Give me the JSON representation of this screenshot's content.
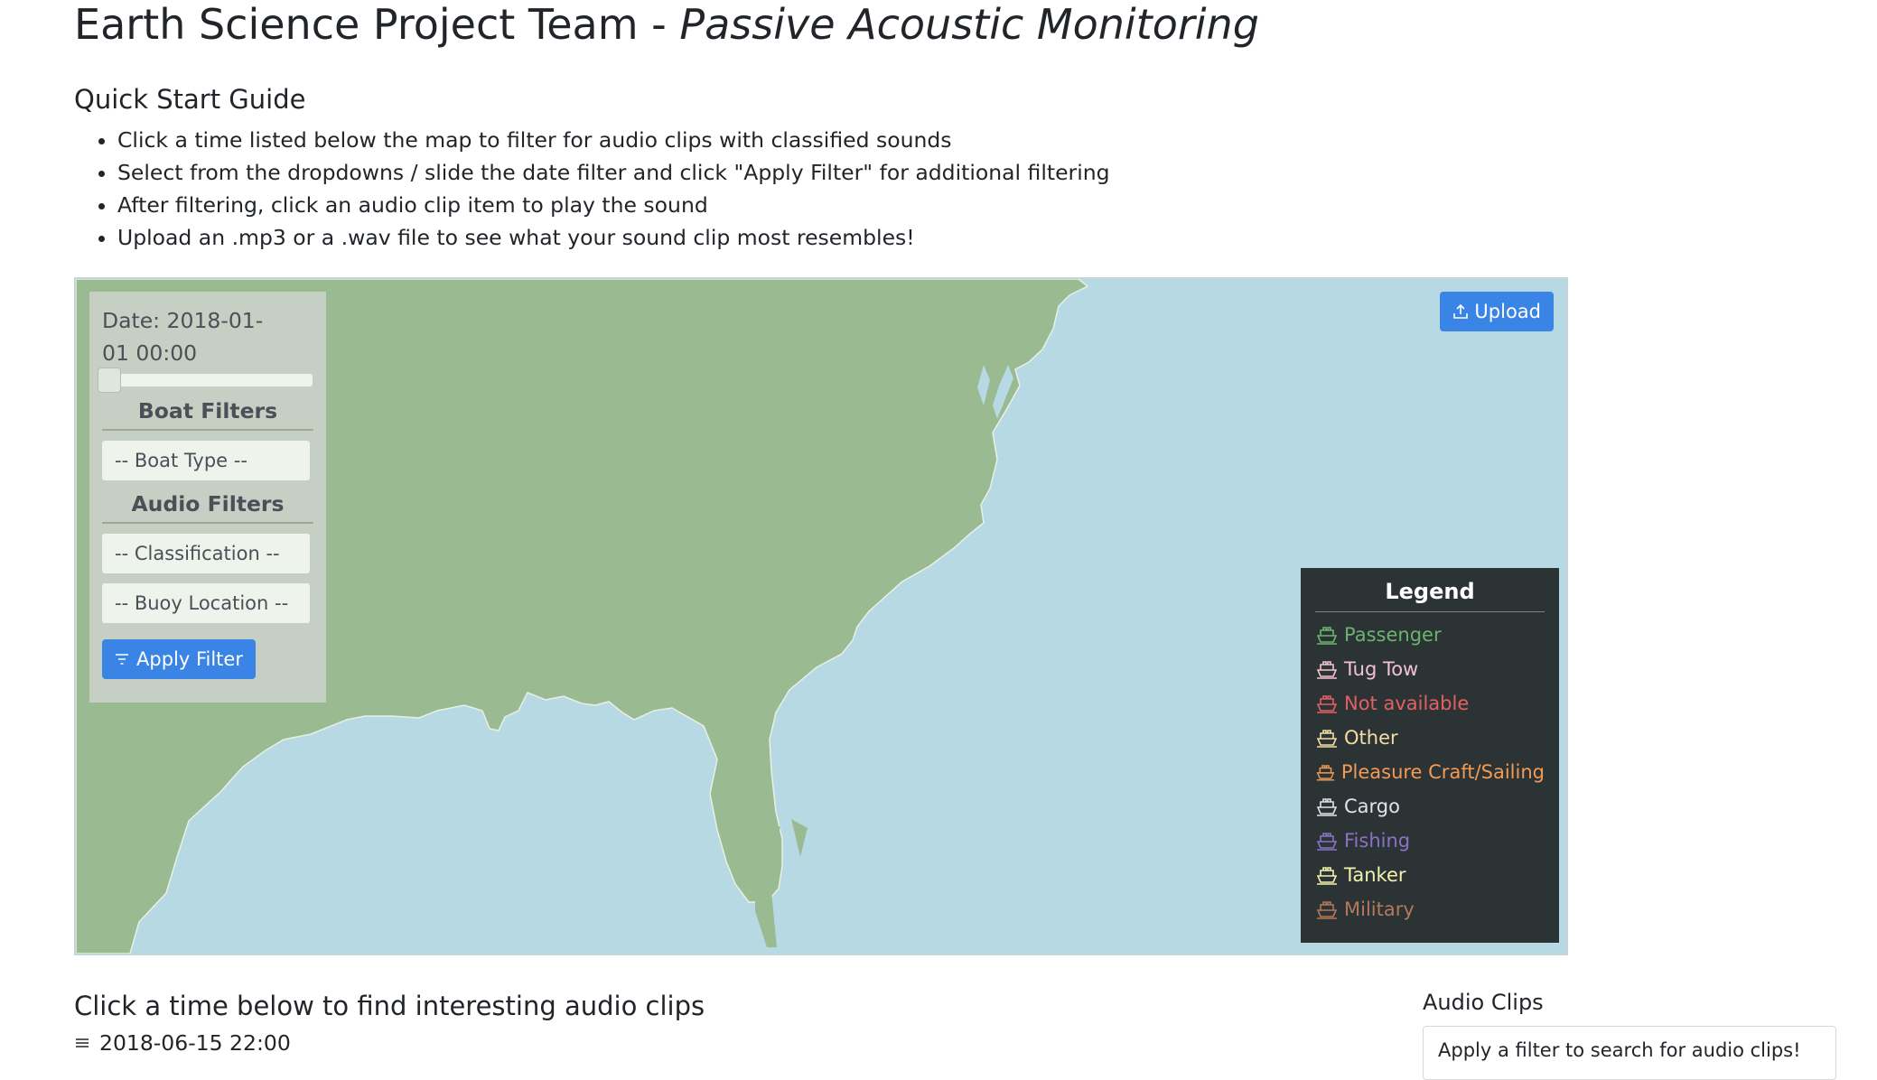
{
  "header": {
    "title_prefix": "Earth Science Project Team - ",
    "title_emphasis": "Passive Acoustic Monitoring"
  },
  "guide": {
    "heading": "Quick Start Guide",
    "items": [
      "Click a time listed below the map to filter for audio clips with classified sounds",
      "Select from the dropdowns / slide the date filter and click \"Apply Filter\" for additional filtering",
      "After filtering, click an audio clip item to play the sound",
      "Upload an .mp3 or a .wav file to see what your sound clip most resembles!"
    ]
  },
  "map": {
    "filters": {
      "date_label": "Date: 2018-01-01 00:00",
      "slider_value": 0,
      "boat_heading": "Boat Filters",
      "boat_type_placeholder": "-- Boat Type --",
      "audio_heading": "Audio Filters",
      "classification_placeholder": "-- Classification --",
      "buoy_placeholder": "-- Buoy Location --",
      "apply_label": "Apply Filter"
    },
    "upload_label": "Upload",
    "legend": {
      "title": "Legend",
      "items": [
        {
          "label": "Passenger",
          "color": "#6cb36f"
        },
        {
          "label": "Tug Tow",
          "color": "#f3c2d0"
        },
        {
          "label": "Not available",
          "color": "#e26063"
        },
        {
          "label": "Other",
          "color": "#f4dca3"
        },
        {
          "label": "Pleasure Craft/Sailing",
          "color": "#f39a55"
        },
        {
          "label": "Cargo",
          "color": "#dfe3ec"
        },
        {
          "label": "Fishing",
          "color": "#8a72c7"
        },
        {
          "label": "Tanker",
          "color": "#f4f2b0"
        },
        {
          "label": "Military",
          "color": "#b5785a"
        }
      ]
    },
    "colors": {
      "land": "#9aba92",
      "water": "#b7d9e4"
    }
  },
  "times": {
    "heading": "Click a time below to find interesting audio clips",
    "first_entry": "2018-06-15 22:00"
  },
  "clips": {
    "heading": "Audio Clips",
    "placeholder": "Apply a filter to search for audio clips!"
  }
}
